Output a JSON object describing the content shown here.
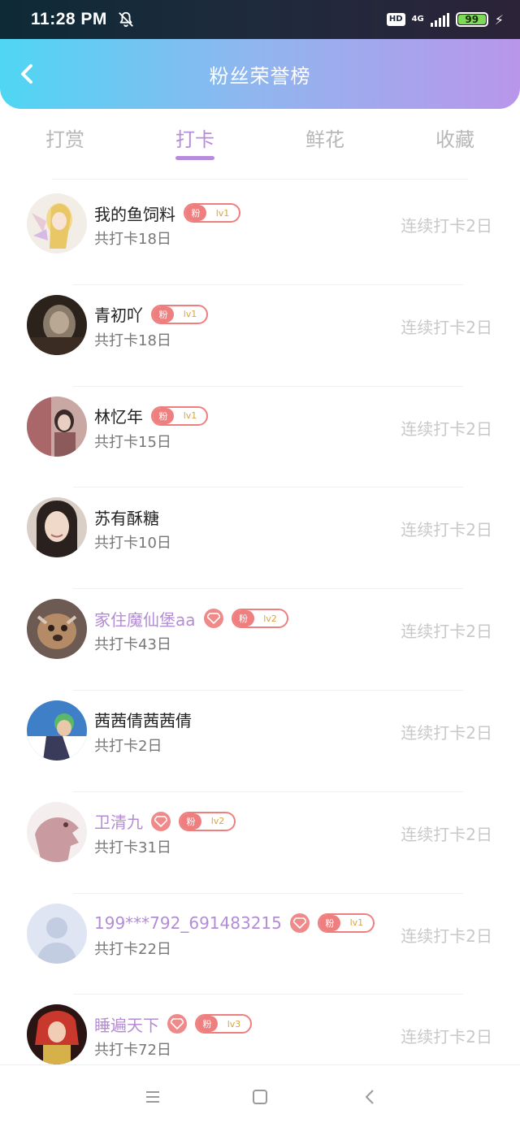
{
  "status_bar": {
    "time": "11:28 PM",
    "network": "4G",
    "hd": "HD",
    "battery": "99",
    "mute_icon": "bell-off-icon"
  },
  "header": {
    "title": "粉丝荣誉榜",
    "back_icon": "chevron-left-icon"
  },
  "tabs": [
    {
      "label": "打赏",
      "active": false
    },
    {
      "label": "打卡",
      "active": true
    },
    {
      "label": "鲜花",
      "active": false
    },
    {
      "label": "收藏",
      "active": false
    }
  ],
  "badge_fan_label": "粉",
  "fans": [
    {
      "name": "我的鱼饲料",
      "vip": false,
      "fan_level": "lv1",
      "total": "共打卡18日",
      "streak": "连续打卡2日"
    },
    {
      "name": "青初吖",
      "vip": false,
      "fan_level": "lv1",
      "total": "共打卡18日",
      "streak": "连续打卡2日"
    },
    {
      "name": "林忆年",
      "vip": false,
      "fan_level": "lv1",
      "total": "共打卡15日",
      "streak": "连续打卡2日"
    },
    {
      "name": "苏有酥糖",
      "vip": false,
      "fan_level": "",
      "total": "共打卡10日",
      "streak": "连续打卡2日"
    },
    {
      "name": "家住魔仙堡aa",
      "vip": true,
      "fan_level": "lv2",
      "total": "共打卡43日",
      "streak": "连续打卡2日"
    },
    {
      "name": "茜茜倩茜茜倩",
      "vip": false,
      "fan_level": "",
      "total": "共打卡2日",
      "streak": "连续打卡2日"
    },
    {
      "name": "卫清九",
      "vip": true,
      "fan_level": "lv2",
      "total": "共打卡31日",
      "streak": "连续打卡2日"
    },
    {
      "name": "199***792_691483215",
      "vip": true,
      "fan_level": "lv1",
      "total": "共打卡22日",
      "streak": "连续打卡2日"
    },
    {
      "name": "睡遍天下",
      "vip": true,
      "fan_level": "lv3",
      "total": "共打卡72日",
      "streak": "连续打卡2日"
    }
  ],
  "colors": {
    "accent": "#b68ddc",
    "vip_name": "#b48cd6",
    "fan_badge": "#ef7f7f",
    "header_gradient_start": "#4fd6f3",
    "header_gradient_end": "#b996ea"
  },
  "nav": {
    "menu_icon": "menu-icon",
    "home_icon": "square-home-icon",
    "back_icon": "triangle-back-icon"
  }
}
